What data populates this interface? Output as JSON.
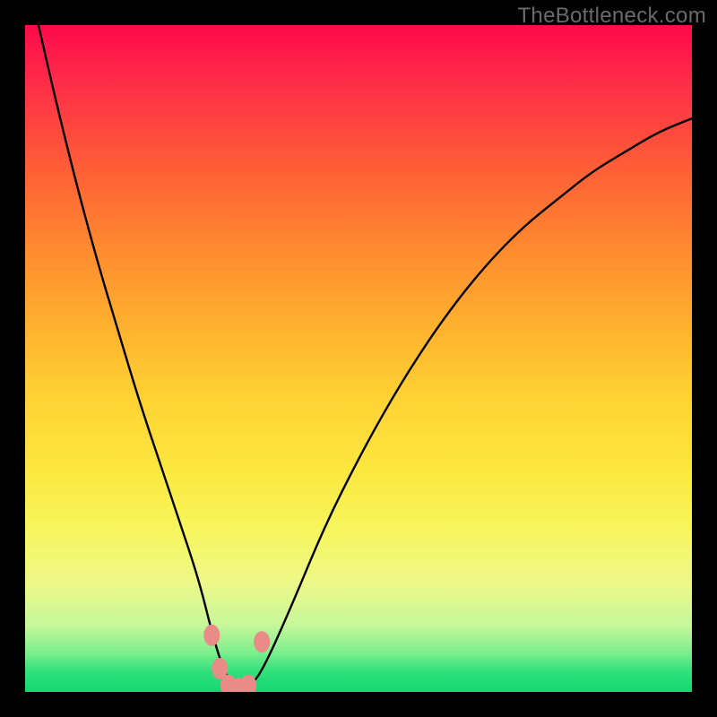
{
  "watermark": "TheBottleneck.com",
  "chart_data": {
    "type": "line",
    "title": "",
    "xlabel": "",
    "ylabel": "",
    "xlim": [
      0,
      100
    ],
    "ylim": [
      0,
      100
    ],
    "series": [
      {
        "name": "bottleneck-curve",
        "x": [
          2,
          5,
          8,
          11,
          14,
          17,
          20,
          23,
          26,
          28,
          29.5,
          31,
          32.5,
          34,
          36,
          40,
          45,
          50,
          55,
          60,
          65,
          70,
          75,
          80,
          85,
          90,
          95,
          100
        ],
        "values": [
          100,
          87,
          75,
          64,
          54,
          44,
          35,
          26,
          17,
          9,
          4,
          1,
          0.5,
          1,
          4,
          13,
          25,
          35,
          44,
          52,
          59,
          65,
          70,
          74,
          78,
          81,
          84,
          86
        ]
      }
    ],
    "markers": [
      {
        "name": "dot-left-upper",
        "x": 28.0,
        "y": 8.5
      },
      {
        "name": "dot-left-lower",
        "x": 29.2,
        "y": 3.5
      },
      {
        "name": "dot-bottom-1",
        "x": 30.5,
        "y": 1.0
      },
      {
        "name": "dot-bottom-2",
        "x": 32.0,
        "y": 0.5
      },
      {
        "name": "dot-bottom-3",
        "x": 33.5,
        "y": 1.0
      },
      {
        "name": "dot-right",
        "x": 35.5,
        "y": 7.5
      }
    ],
    "gradient_stops": [
      {
        "pos": 0,
        "color": "#ff0a4a"
      },
      {
        "pos": 22,
        "color": "#ff6036"
      },
      {
        "pos": 45,
        "color": "#ffb02f"
      },
      {
        "pos": 67,
        "color": "#fce83f"
      },
      {
        "pos": 90,
        "color": "#c6f79a"
      },
      {
        "pos": 100,
        "color": "#14d76f"
      }
    ]
  }
}
